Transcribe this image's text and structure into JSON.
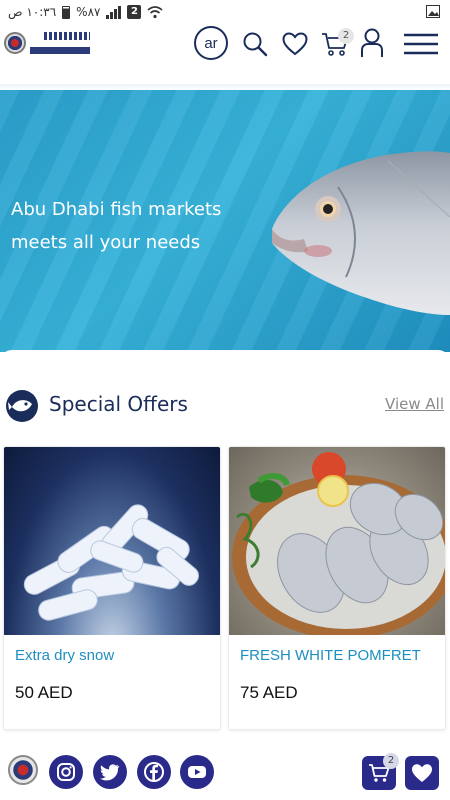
{
  "status_bar": {
    "time": "١٠:٣٦ ص",
    "battery": "%٨٧",
    "sim_badge": "2",
    "icons": [
      "battery-icon",
      "signal-icon",
      "wifi-icon",
      "gallery-icon"
    ]
  },
  "header": {
    "logo_alt": "Abu Dhabi Cooperative Society",
    "language_button": "ar",
    "cart_count": "2",
    "icons": [
      "search-icon",
      "heart-icon",
      "cart-icon",
      "user-icon",
      "menu-icon"
    ]
  },
  "hero": {
    "line1": "Abu Dhabi fish markets",
    "line2": "meets all your needs"
  },
  "offers": {
    "title": "Special Offers",
    "view_all": "View All",
    "items": [
      {
        "name": "Extra dry snow",
        "price": "50 AED",
        "image": "dry-ice-image"
      },
      {
        "name": "FRESH WHITE POMFRET",
        "price": "75 AED",
        "image": "pomfret-image"
      }
    ]
  },
  "footer": {
    "cart_count": "2",
    "social": [
      "instagram-icon",
      "twitter-icon",
      "facebook-icon",
      "youtube-icon"
    ]
  },
  "colors": {
    "brand_navy": "#1a2d5a",
    "product_blue": "#1e8fc0",
    "footer_purple": "#2a2a8a",
    "hero_blue": "#2fa8d5"
  }
}
